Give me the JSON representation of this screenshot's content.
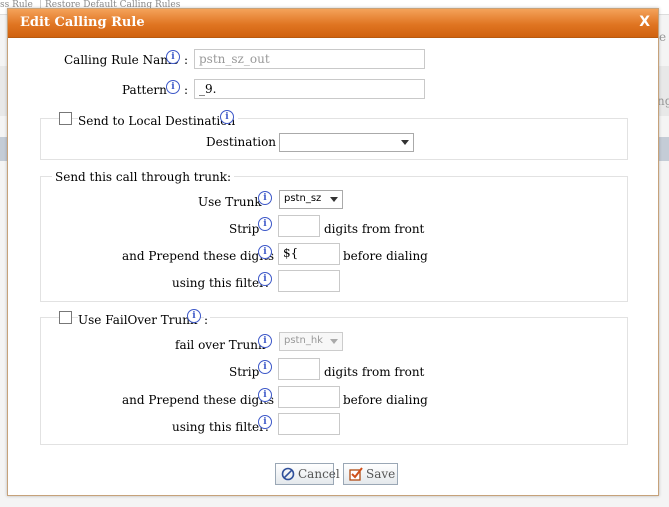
{
  "background": {
    "tab1": "ss Rule",
    "tab2": "Restore Default Calling Rules",
    "right_fragment_1": "e",
    "right_fragment_2": "ng"
  },
  "dialog": {
    "title": "Edit Calling Rule",
    "close_label": "X",
    "calling_rule_name": {
      "label": "Calling Rule Name",
      "value": "pstn_sz_out"
    },
    "pattern": {
      "label": "Pattern",
      "value": "_9."
    },
    "local_destination": {
      "checkbox_label": "Send to Local Destination",
      "checked": false,
      "destination_label": "Destination :",
      "destination_value": ""
    },
    "trunk_section": {
      "legend": "Send this call through trunk:",
      "use_trunk_label": "Use Trunk",
      "use_trunk_value": "pstn_sz",
      "strip_label": "Strip",
      "strip_value": "",
      "strip_suffix": "digits from front",
      "prepend_label": "and Prepend these digits",
      "prepend_value": "${",
      "prepend_suffix": "before dialing",
      "filter_label": "using this filter:",
      "filter_value": ""
    },
    "failover_section": {
      "checkbox_label": "Use FailOver Trunk",
      "checked": false,
      "colon": ":",
      "failover_trunk_label": "fail over Trunk",
      "failover_trunk_value": "pstn_hk",
      "strip_label": "Strip",
      "strip_value": "",
      "strip_suffix": "digits from front",
      "prepend_label": "and Prepend these digits",
      "prepend_value": "",
      "prepend_suffix": "before dialing",
      "filter_label": "using this filter:",
      "filter_value": ""
    },
    "buttons": {
      "cancel": "Cancel",
      "save": "Save"
    }
  },
  "colors": {
    "titlebar_start": "#f4a25a",
    "titlebar_end": "#d0620f",
    "info_icon": "#3c57c8",
    "save_check": "#d0501a"
  },
  "icons": [
    "info-icon",
    "close-icon",
    "cancel-icon",
    "save-icon",
    "chevron-down-icon"
  ]
}
